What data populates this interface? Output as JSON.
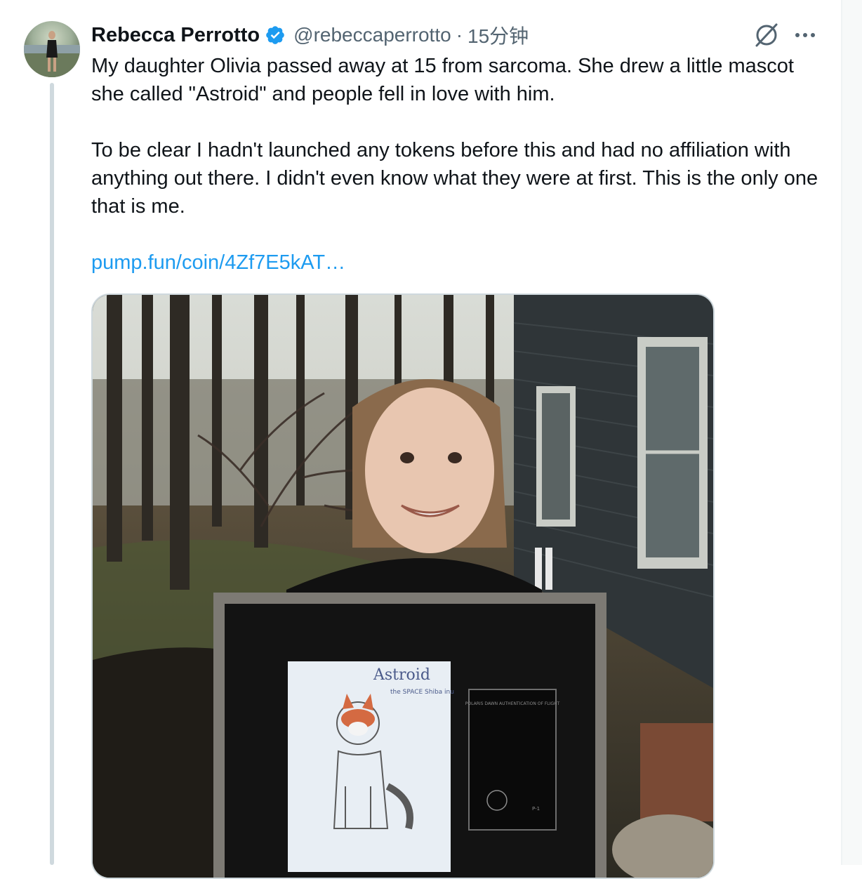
{
  "tweet": {
    "author_name": "Rebecca Perrotto",
    "handle": "@rebeccaperrotto",
    "separator": "·",
    "time": "15分钟",
    "paragraphs": [
      "My daughter Olivia passed away at 15 from sarcoma. She drew a little mascot she called \"Astroid\" and people fell in love with him.",
      "To be clear I hadn't launched any tokens before this and had no affiliation with anything out there. I didn't even know what they were at first. This is the only one that is me."
    ],
    "link_text": "pump.fun/coin/4Zf7E5kAT…"
  },
  "media": {
    "drawing_title": "Astroid",
    "drawing_subtitle": "the SPACE Shiba inu",
    "certificate_title": "POLARIS DAWN AUTHENTICATION OF FLIGHT",
    "certificate_code": "P-1"
  },
  "colors": {
    "text": "#0f1419",
    "secondary": "#536471",
    "link": "#1d9bf0",
    "verified": "#1d9bf0"
  },
  "icons": {
    "verified": "verified-badge-icon",
    "grok": "grok-icon",
    "more": "more-icon"
  }
}
